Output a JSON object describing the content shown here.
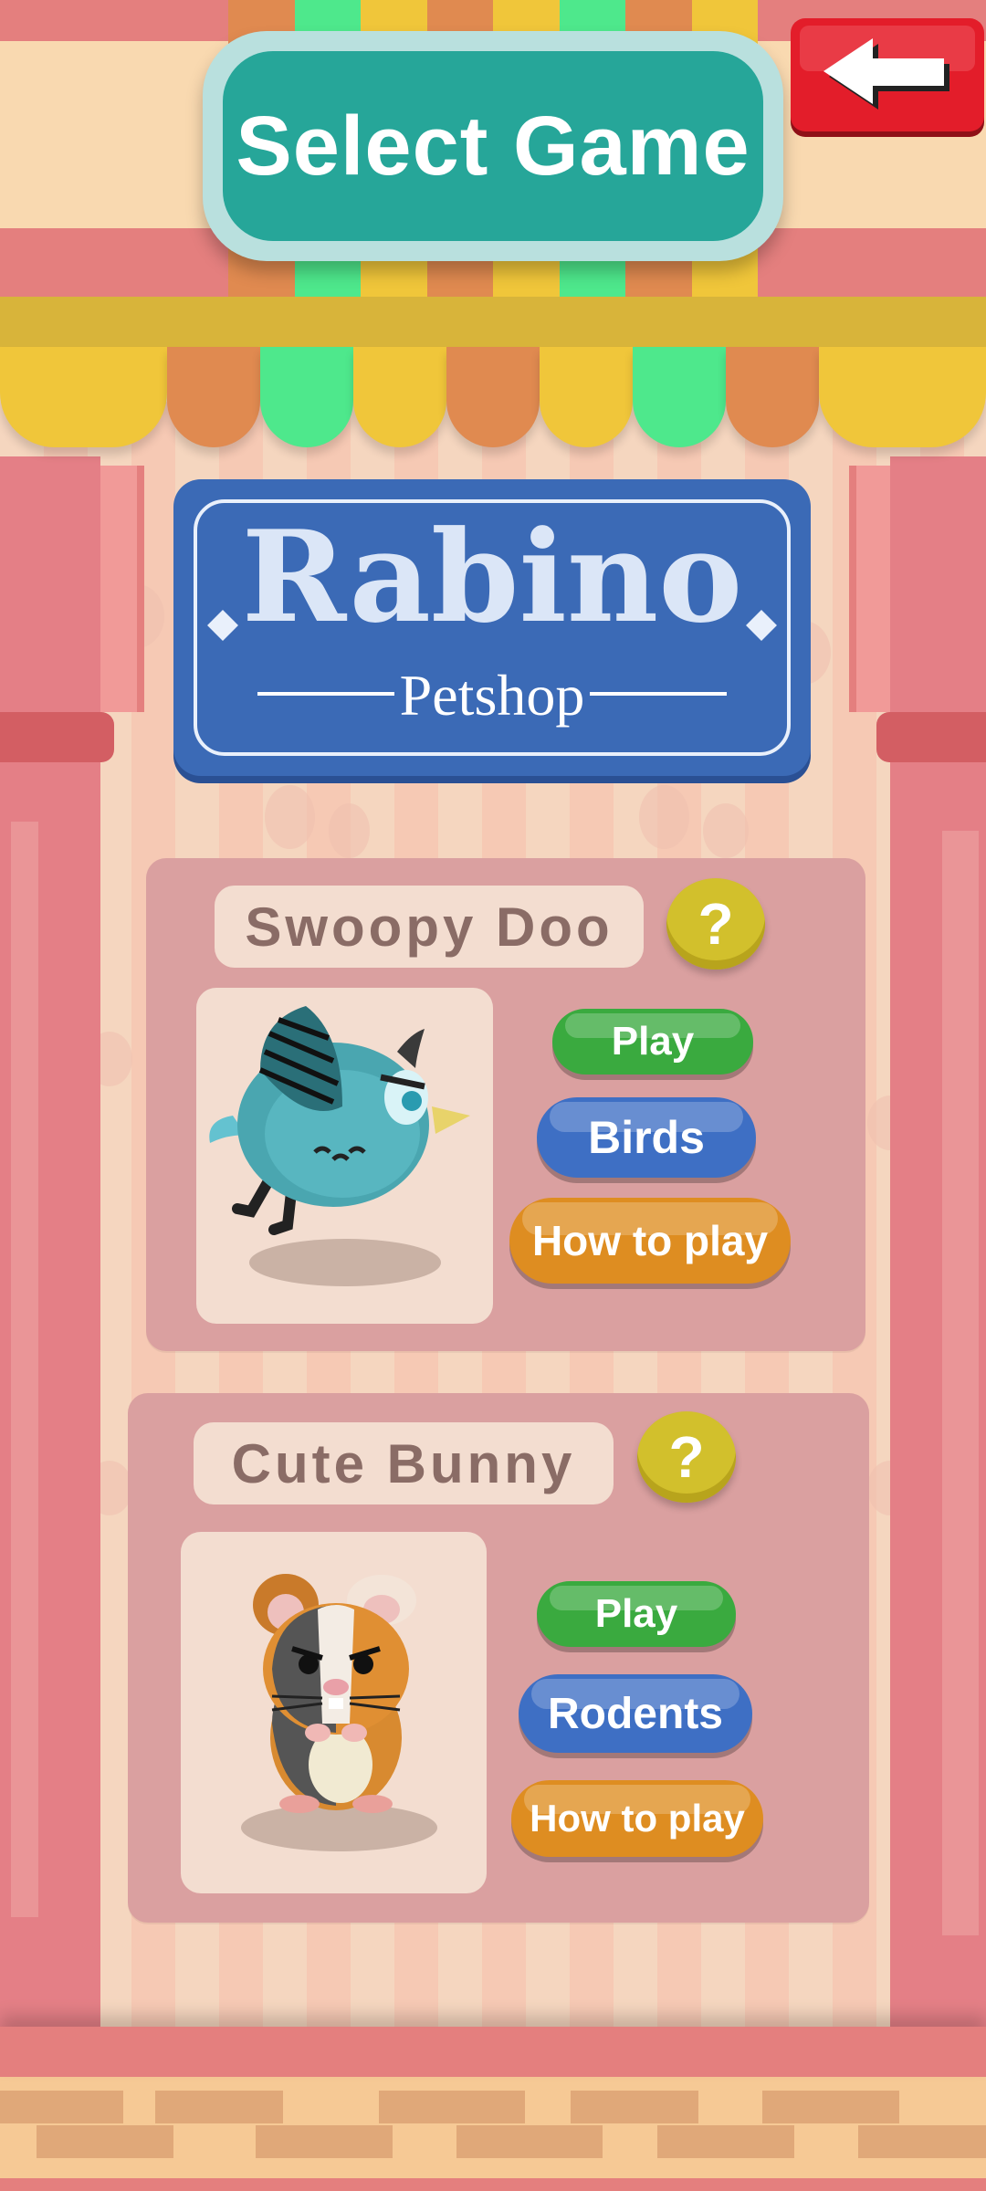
{
  "header": {
    "title": "Select Game"
  },
  "sign": {
    "title": "Rabino",
    "subtitle": "Petshop"
  },
  "games": [
    {
      "name": "Swoopy Doo",
      "help": "?",
      "play": "Play",
      "category": "Birds",
      "how_to_play": "How to play"
    },
    {
      "name": "Cute Bunny",
      "help": "?",
      "play": "Play",
      "category": "Rodents",
      "how_to_play": "How to play"
    }
  ],
  "colors": {
    "title_green": "#26a699",
    "sign_blue": "#3b6ab6",
    "play_green": "#3aaa3f",
    "category_blue": "#3e6fc4",
    "how_orange": "#de8d21",
    "help_yellow": "#d2c02c",
    "back_red": "#e31d2a"
  },
  "icons": {
    "back": "back-arrow-icon",
    "help": "question-mark-icon"
  }
}
